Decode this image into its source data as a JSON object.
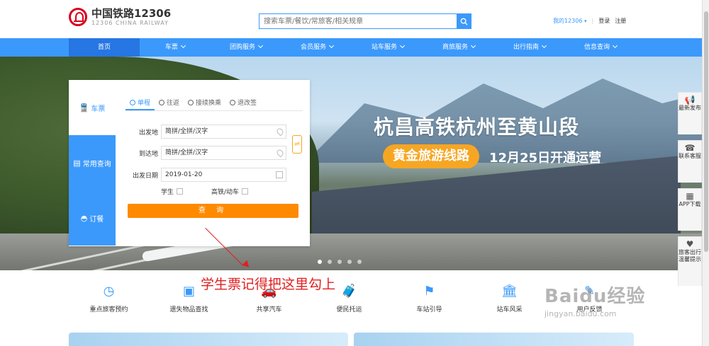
{
  "header": {
    "logo_title": "中国铁路12306",
    "logo_sub": "12306 CHINA RAILWAY",
    "search_placeholder": "搜索车票/餐饮/常旅客/相关规章",
    "my_label": "我的12306",
    "login": "登录",
    "register": "注册"
  },
  "nav": {
    "items": [
      {
        "label": "首页",
        "active": true
      },
      {
        "label": "车票"
      },
      {
        "label": "团购服务"
      },
      {
        "label": "会员服务"
      },
      {
        "label": "站车服务"
      },
      {
        "label": "商旅服务"
      },
      {
        "label": "出行指南"
      },
      {
        "label": "信息查询"
      }
    ]
  },
  "banner": {
    "headline": "杭昌高铁杭州至黄山段",
    "pill": "黄金旅游线路",
    "date_text": "12月25日开通运营"
  },
  "booking": {
    "side_tabs": [
      "车票",
      "常用查询",
      "订餐"
    ],
    "trip_tabs": [
      "单程",
      "往返",
      "接续换乘",
      "退改签"
    ],
    "from_label": "出发地",
    "from_placeholder": "简拼/全拼/汉字",
    "to_label": "到达地",
    "to_placeholder": "简拼/全拼/汉字",
    "date_label": "出发日期",
    "date_value": "2019-01-20",
    "student_label": "学生",
    "highspeed_label": "高铁/动车",
    "query_button": "查 询"
  },
  "float_bar": [
    {
      "icon": "megaphone-icon",
      "label": "最新发布"
    },
    {
      "icon": "headset-icon",
      "label": "联系客服"
    },
    {
      "icon": "qrcode-icon",
      "label": "APP下载"
    },
    {
      "icon": "heart-hand-icon",
      "label": "旅客出行温馨提示"
    }
  ],
  "annotation": "学生票记得把这里勾上",
  "services": [
    {
      "icon": "person-clock-icon",
      "label": "重点旅客预约"
    },
    {
      "icon": "box-icon",
      "label": "遗失物品查找"
    },
    {
      "icon": "car-icon",
      "label": "共享汽车"
    },
    {
      "icon": "luggage-icon",
      "label": "便民托运"
    },
    {
      "icon": "signpost-icon",
      "label": "车站引导"
    },
    {
      "icon": "building-icon",
      "label": "站车风采"
    },
    {
      "icon": "feedback-icon",
      "label": "用户反馈"
    }
  ],
  "watermark": {
    "main": "Baidu经验",
    "sub": "jingyan.baidu.com"
  },
  "colors": {
    "primary": "#3b99fc",
    "nav_active": "#2676e3",
    "accent": "#ff8a00",
    "annotation": "#e02020"
  }
}
